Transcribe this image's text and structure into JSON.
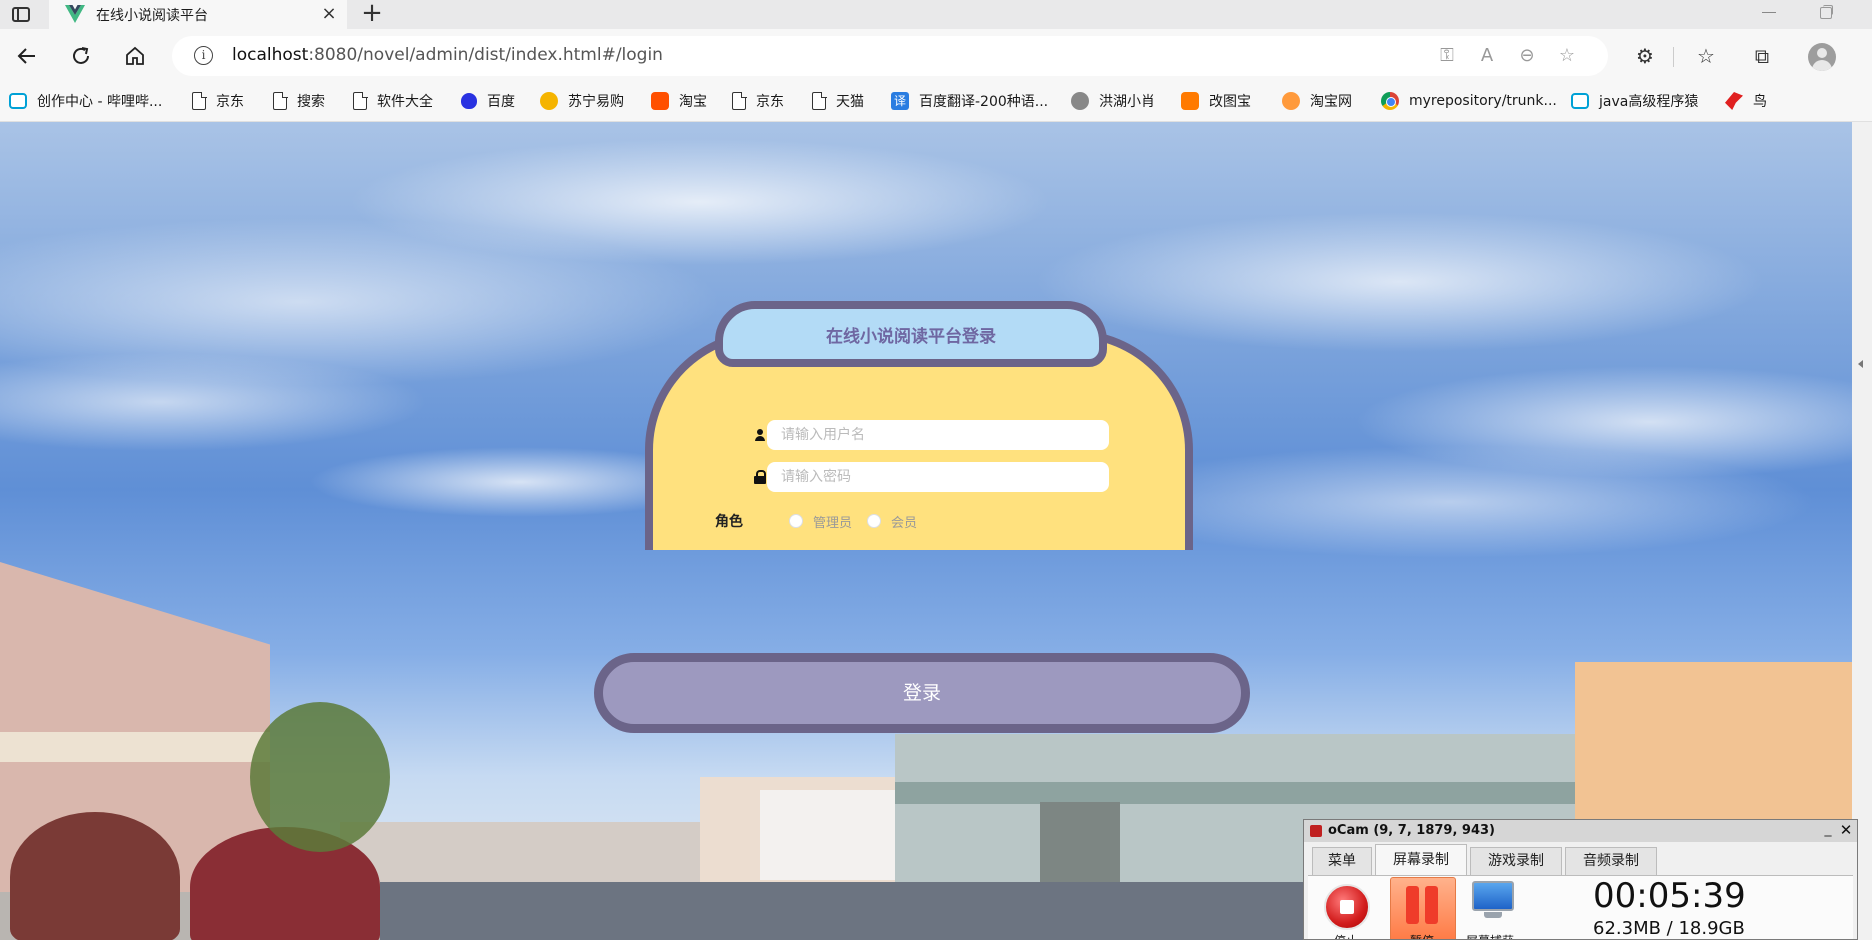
{
  "browser": {
    "tab_title": "在线小说阅读平台",
    "close_tab_glyph": "×",
    "new_tab_glyph": "+",
    "url_host": "localhost",
    "url_rest": ":8080/novel/admin/dist/index.html#/login",
    "icons": {
      "back": "arrow-left-icon",
      "refresh": "refresh-icon",
      "home": "home-icon",
      "info": "info-icon"
    }
  },
  "bookmarks": [
    {
      "label": "创作中心 - 哔哩哔...",
      "icon": "bilibili-icon"
    },
    {
      "label": "京东",
      "icon": "page-icon"
    },
    {
      "label": "搜索",
      "icon": "page-icon"
    },
    {
      "label": "软件大全",
      "icon": "page-icon"
    },
    {
      "label": "百度",
      "icon": "baidu-icon"
    },
    {
      "label": "苏宁易购",
      "icon": "suning-icon"
    },
    {
      "label": "淘宝",
      "icon": "taobao-icon"
    },
    {
      "label": "京东",
      "icon": "page-icon"
    },
    {
      "label": "天猫",
      "icon": "page-icon"
    },
    {
      "label": "百度翻译-200种语...",
      "icon": "translate-icon"
    },
    {
      "label": "洪湖小肖",
      "icon": "avatar-icon"
    },
    {
      "label": "改图宝",
      "icon": "gaitubao-icon"
    },
    {
      "label": "淘宝网",
      "icon": "taobao-icon"
    },
    {
      "label": "myrepository/trunk...",
      "icon": "chrome-icon"
    },
    {
      "label": "java高级程序猿",
      "icon": "bilibili-icon"
    },
    {
      "label": "鸟",
      "icon": "bird-icon"
    }
  ],
  "login": {
    "title": "在线小说阅读平台登录",
    "username_placeholder": "请输入用户名",
    "password_placeholder": "请输入密码",
    "role_label": "角色",
    "role_options": [
      "管理员",
      "会员"
    ],
    "submit_label": "登录"
  },
  "ocam": {
    "title": "oCam (9, 7, 1879, 943)",
    "min_glyph": "_",
    "close_glyph": "✕",
    "tabs": [
      "菜单",
      "屏幕录制",
      "游戏录制",
      "音频录制"
    ],
    "active_tab": "屏幕录制",
    "stop_label": "停止",
    "pause_label": "暂停",
    "capture_label": "屏幕捕获",
    "elapsed": "00:05:39",
    "size": "62.3MB / 18.9GB"
  },
  "colors": {
    "card_fill": "#ffe17e",
    "card_border": "#6b6489",
    "title_pill": "#b3dbf6",
    "title_text": "#6f67a2",
    "button_fill": "#9d99bf"
  }
}
